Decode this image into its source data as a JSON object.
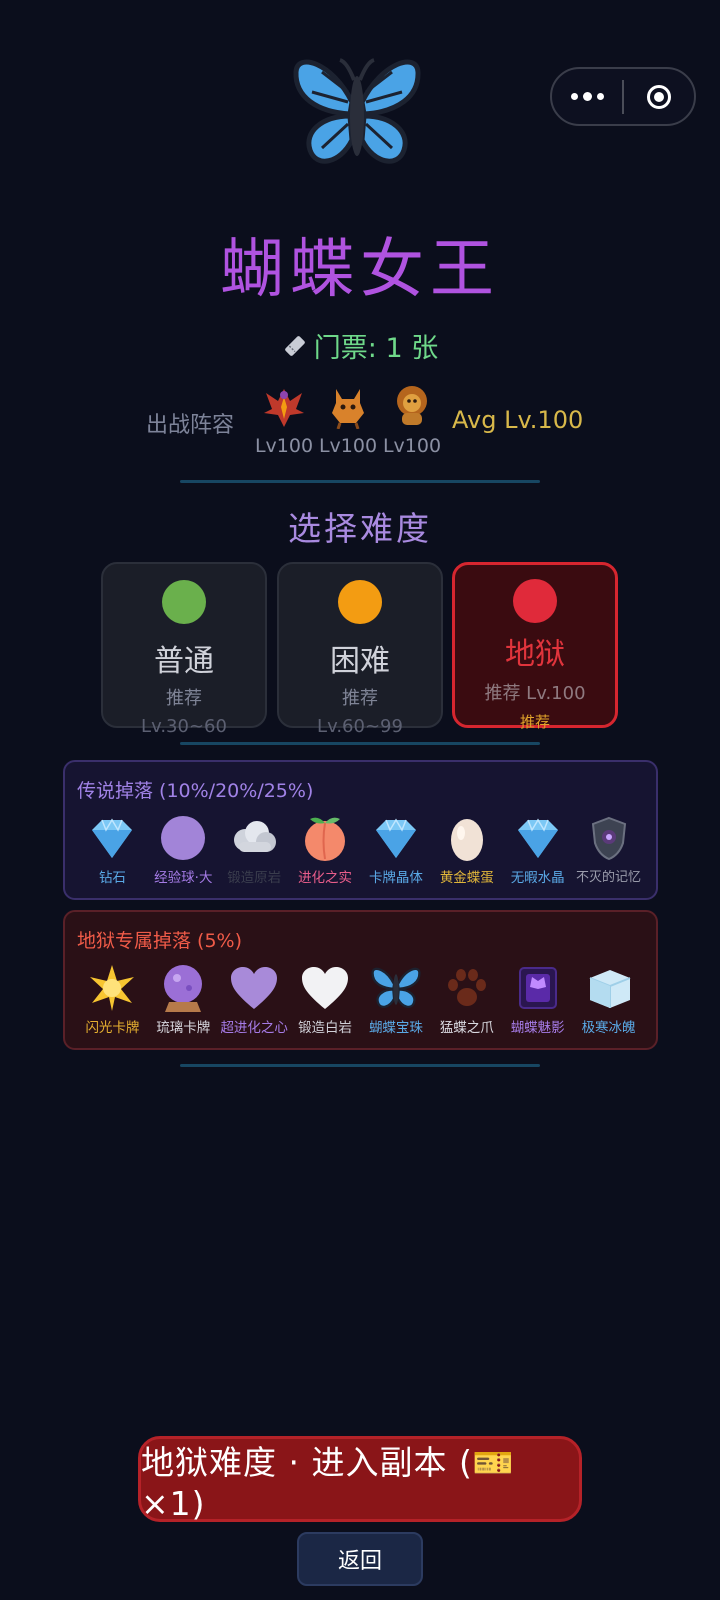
{
  "boss": {
    "name": "蝴蝶女王",
    "ticket_label": "门票: 1 张"
  },
  "team": {
    "label": "出战阵容",
    "pets": [
      {
        "level": "Lv100"
      },
      {
        "level": "Lv100"
      },
      {
        "level": "Lv100"
      }
    ],
    "avg": "Avg Lv.100"
  },
  "difficulty": {
    "title": "选择难度",
    "options": [
      {
        "name": "普通",
        "rec": "推荐",
        "range": "Lv.30~60",
        "color": "#6ab04c"
      },
      {
        "name": "困难",
        "rec": "推荐",
        "range": "Lv.60~99",
        "color": "#f39c12"
      },
      {
        "name": "地狱",
        "rec": "推荐 Lv.100",
        "badge": "推荐",
        "color": "#e02a3a",
        "selected": true
      }
    ]
  },
  "legend_drops": {
    "title": "传说掉落 (10%/20%/25%)",
    "items": [
      {
        "icon": "diamond-icon",
        "name": "钻石",
        "color": "#5aa9e6"
      },
      {
        "icon": "exp-orb-icon",
        "name": "经验球·大",
        "color": "#a57be6"
      },
      {
        "icon": "cloud-ore-icon",
        "name": "锻造原岩",
        "color": "#3a3d4d"
      },
      {
        "icon": "peach-icon",
        "name": "进化之实",
        "color": "#e85d8a"
      },
      {
        "icon": "diamond-icon",
        "name": "卡牌晶体",
        "color": "#5aa9e6"
      },
      {
        "icon": "egg-icon",
        "name": "黄金蝶蛋",
        "color": "#e0b63a"
      },
      {
        "icon": "diamond-icon",
        "name": "无暇水晶",
        "color": "#5aa9e6"
      },
      {
        "icon": "shield-icon",
        "name": "不灭的记忆",
        "color": "#9a9cab"
      }
    ]
  },
  "hell_drops": {
    "title": "地狱专属掉落 (5%)",
    "items": [
      {
        "icon": "star-icon",
        "name": "闪光卡牌",
        "color": "#e6b030"
      },
      {
        "icon": "crystal-ball-icon",
        "name": "琉璃卡牌",
        "color": "#d9d9e0"
      },
      {
        "icon": "purple-heart-icon",
        "name": "超进化之心",
        "color": "#a57be6"
      },
      {
        "icon": "white-heart-icon",
        "name": "锻造白岩",
        "color": "#d0d0d8"
      },
      {
        "icon": "butterfly-icon",
        "name": "蝴蝶宝珠",
        "color": "#5aa9e6"
      },
      {
        "icon": "paw-icon",
        "name": "猛蝶之爪",
        "color": "#d9d9e0"
      },
      {
        "icon": "shadow-card-icon",
        "name": "蝴蝶魅影",
        "color": "#a57be6"
      },
      {
        "icon": "ice-cube-icon",
        "name": "极寒冰魄",
        "color": "#5aa9e6"
      }
    ]
  },
  "actions": {
    "enter": "地狱难度 · 进入副本 (🎫×1)",
    "back": "返回"
  },
  "colors": {
    "background": "#0b0e1c",
    "title": "#b053e0",
    "ticket": "#6fd98a",
    "hell": "#e02a3a"
  }
}
